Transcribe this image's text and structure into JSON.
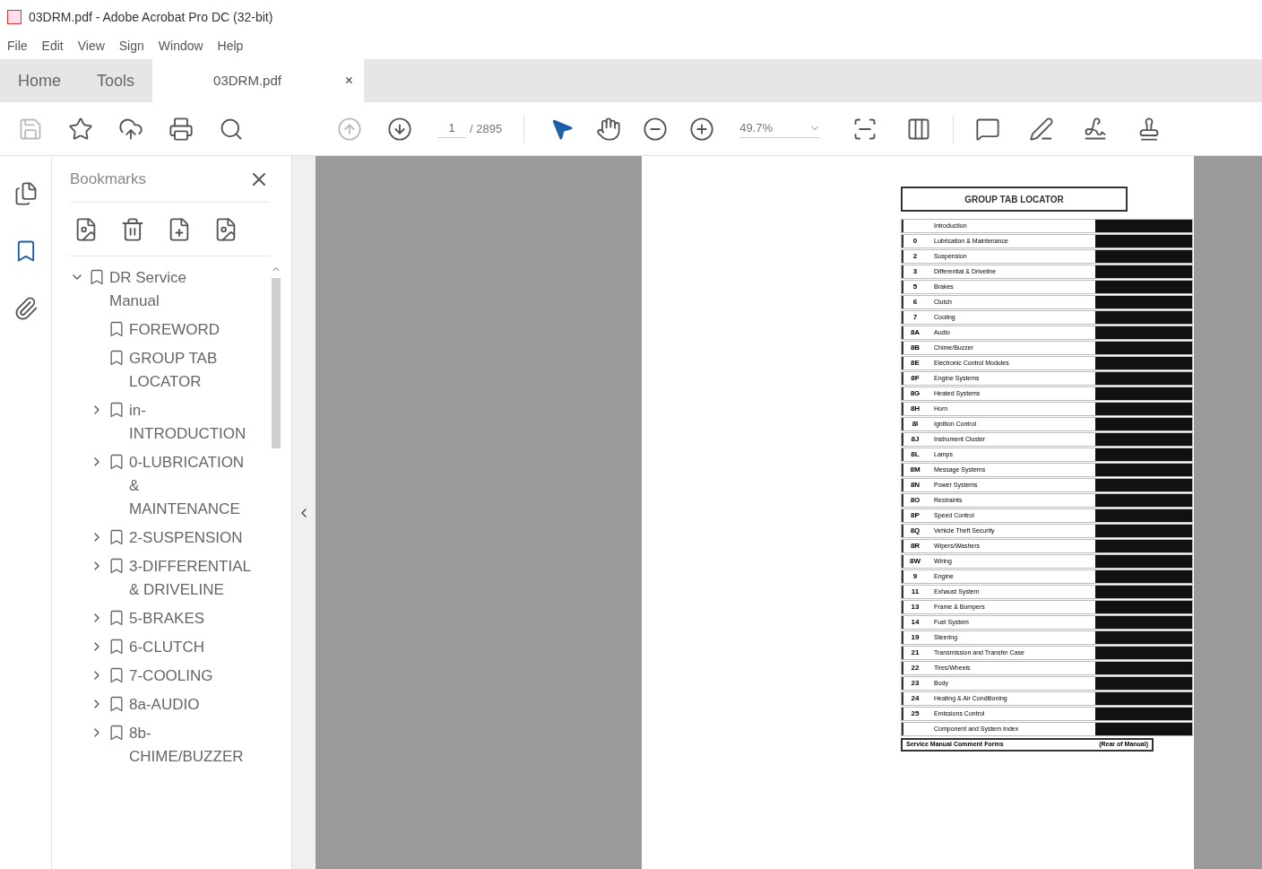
{
  "window": {
    "title": "03DRM.pdf - Adobe Acrobat Pro DC (32-bit)"
  },
  "menu": [
    "File",
    "Edit",
    "View",
    "Sign",
    "Window",
    "Help"
  ],
  "tabs": [
    {
      "label": "Home",
      "selected": false,
      "kind": "nav"
    },
    {
      "label": "Tools",
      "selected": false,
      "kind": "nav"
    },
    {
      "label": "03DRM.pdf",
      "selected": true,
      "kind": "document",
      "close": "×"
    }
  ],
  "toolbar": {
    "page": "1",
    "page_count": "/ 2895",
    "zoom": "49.7%"
  },
  "bookmarks": {
    "title": "Bookmarks",
    "tree": [
      {
        "label": "DR Service Manual",
        "expanded": true,
        "children": [
          {
            "label": "FOREWORD"
          },
          {
            "label": "GROUP TAB LOCATOR"
          },
          {
            "label": "in-INTRODUCTION",
            "expanded": false
          },
          {
            "label": "0-LUBRICATION & MAINTENANCE",
            "expanded": false
          },
          {
            "label": "2-SUSPENSION",
            "expanded": false
          },
          {
            "label": "3-DIFFERENTIAL & DRIVELINE",
            "expanded": false
          },
          {
            "label": "5-BRAKES",
            "expanded": false
          },
          {
            "label": "6-CLUTCH",
            "expanded": false
          },
          {
            "label": "7-COOLING",
            "expanded": false
          },
          {
            "label": "8a-AUDIO",
            "expanded": false
          },
          {
            "label": "8b-CHIME/BUZZER",
            "expanded": false
          }
        ]
      }
    ]
  },
  "document": {
    "title": "GROUP TAB LOCATOR",
    "rows": [
      {
        "code": "",
        "label": "Introduction"
      },
      {
        "code": "0",
        "label": "Lubrication & Maintenance"
      },
      {
        "code": "2",
        "label": "Suspension"
      },
      {
        "code": "3",
        "label": "Differential & Driveline"
      },
      {
        "code": "5",
        "label": "Brakes"
      },
      {
        "code": "6",
        "label": "Clutch"
      },
      {
        "code": "7",
        "label": "Cooling"
      },
      {
        "code": "8A",
        "label": "Audio"
      },
      {
        "code": "8B",
        "label": "Chime/Buzzer"
      },
      {
        "code": "8E",
        "label": "Electronic Control Modules"
      },
      {
        "code": "8F",
        "label": "Engine Systems"
      },
      {
        "code": "8G",
        "label": "Heated Systems"
      },
      {
        "code": "8H",
        "label": "Horn"
      },
      {
        "code": "8I",
        "label": "Ignition Control"
      },
      {
        "code": "8J",
        "label": "Instrument Cluster"
      },
      {
        "code": "8L",
        "label": "Lamps"
      },
      {
        "code": "8M",
        "label": "Message Systems"
      },
      {
        "code": "8N",
        "label": "Power Systems"
      },
      {
        "code": "8O",
        "label": "Restraints"
      },
      {
        "code": "8P",
        "label": "Speed Control"
      },
      {
        "code": "8Q",
        "label": "Vehicle Theft Security"
      },
      {
        "code": "8R",
        "label": "Wipers/Washers"
      },
      {
        "code": "8W",
        "label": "Wiring"
      },
      {
        "code": "9",
        "label": "Engine"
      },
      {
        "code": "11",
        "label": "Exhaust System"
      },
      {
        "code": "13",
        "label": "Frame & Bumpers"
      },
      {
        "code": "14",
        "label": "Fuel System"
      },
      {
        "code": "19",
        "label": "Steering"
      },
      {
        "code": "21",
        "label": "Transmission and Transfer Case"
      },
      {
        "code": "22",
        "label": "Tires/Wheels"
      },
      {
        "code": "23",
        "label": "Body"
      },
      {
        "code": "24",
        "label": "Heating & Air Conditioning"
      },
      {
        "code": "25",
        "label": "Emissions Control"
      },
      {
        "code": "",
        "label": "Component and System Index"
      }
    ],
    "footer": [
      "Service Manual Comment Forms",
      "(Rear of Manual)"
    ]
  }
}
